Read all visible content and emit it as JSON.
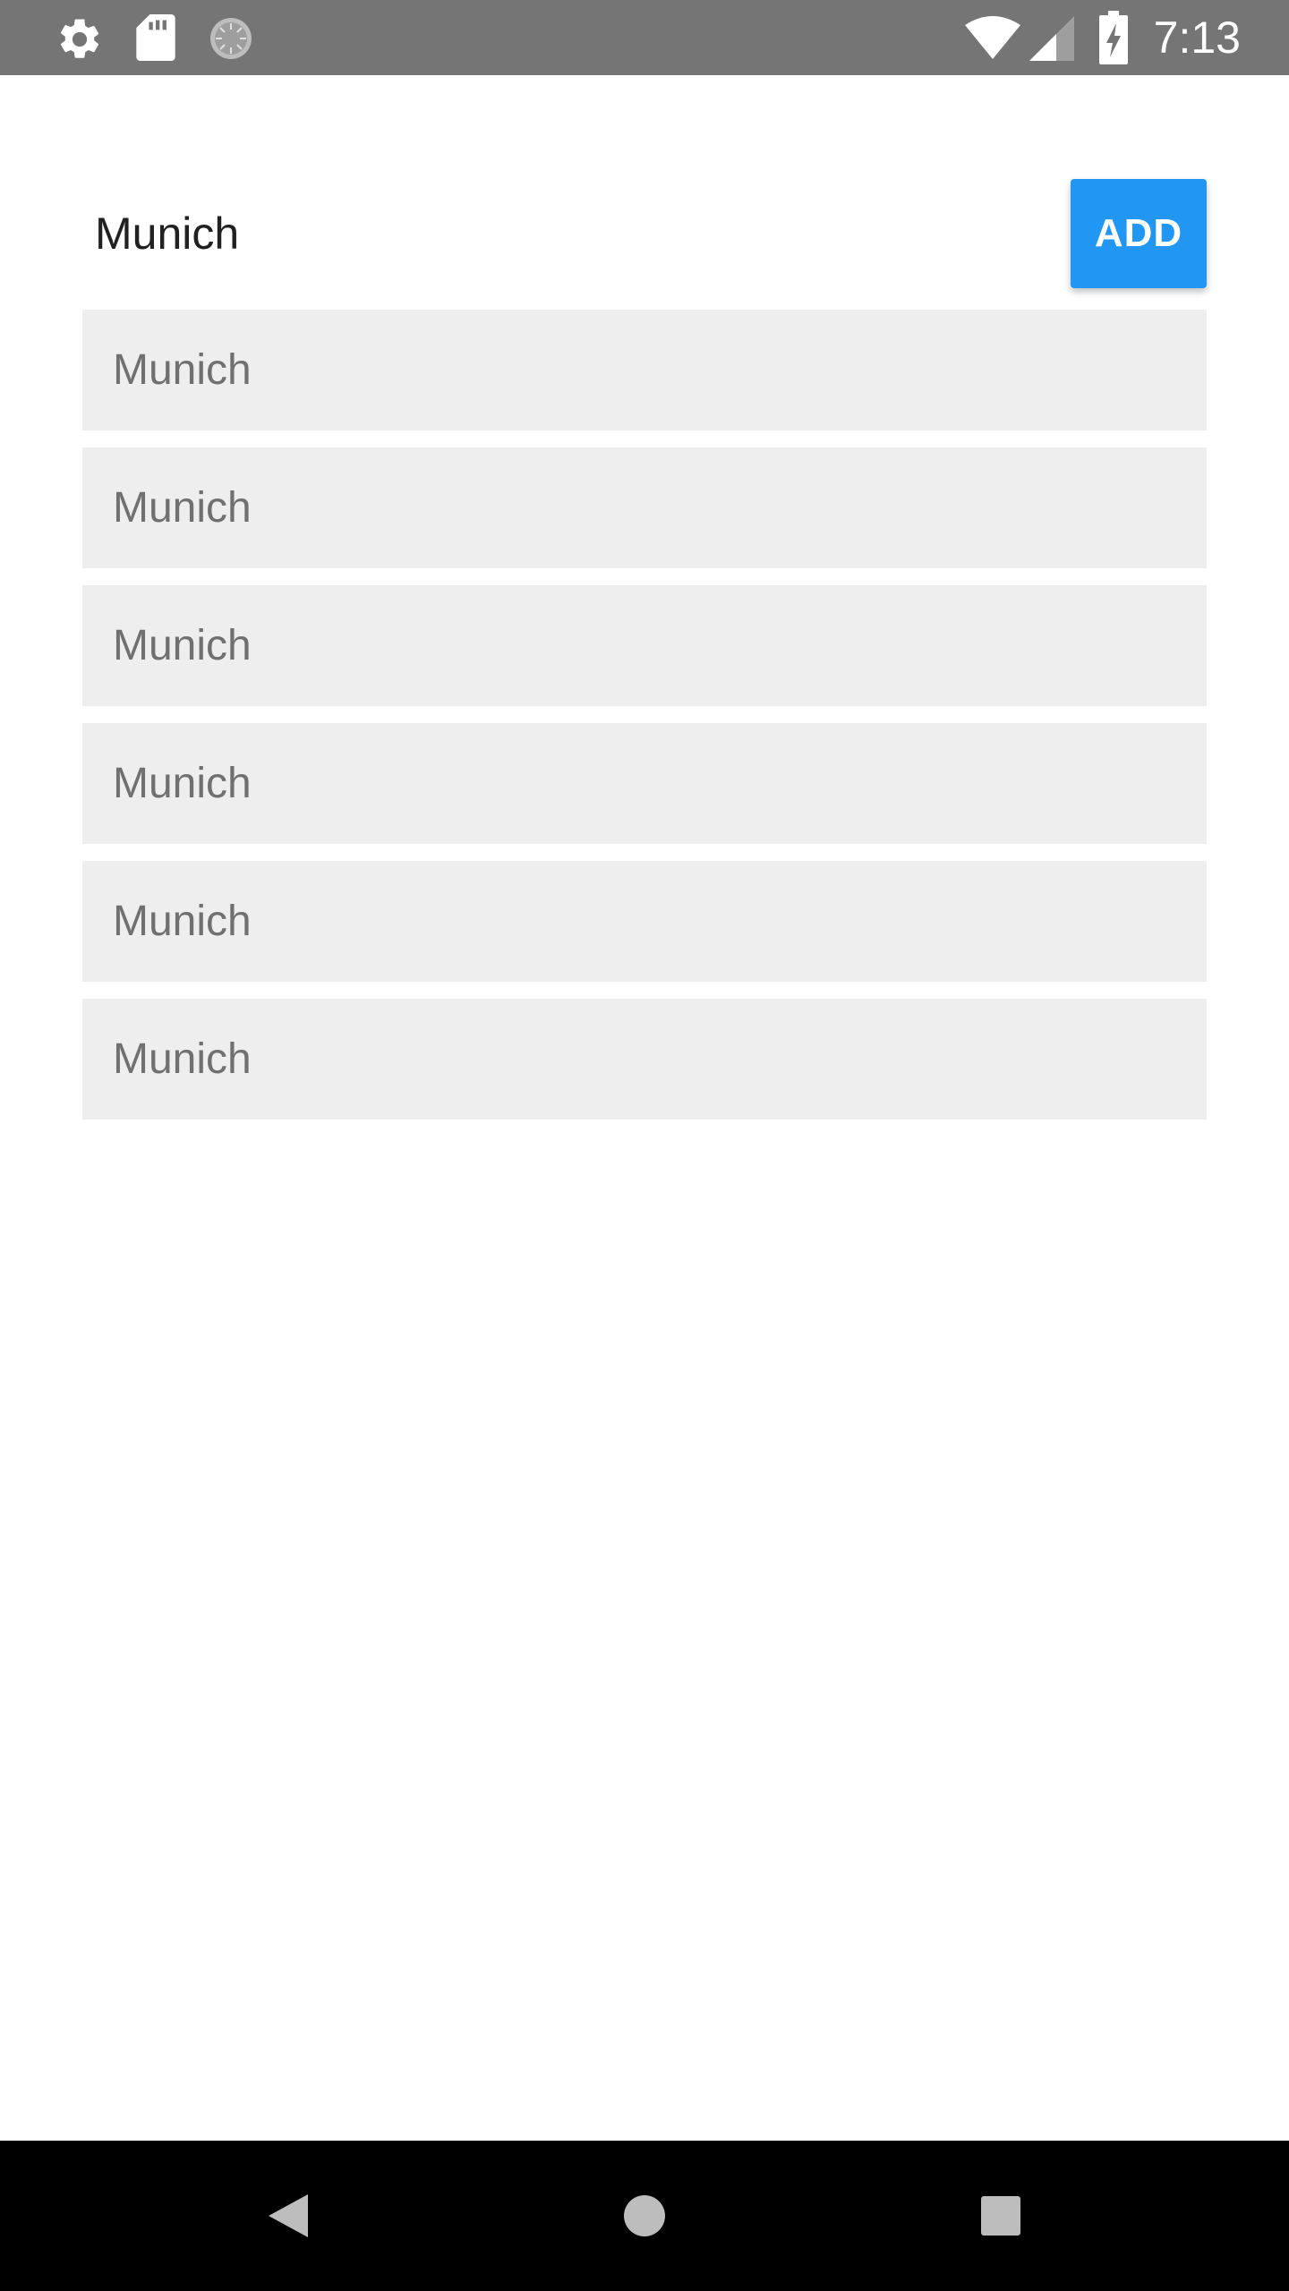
{
  "status_bar": {
    "time": "7:13",
    "icons": [
      "gear-icon",
      "sd-card-icon",
      "loading-spinner-icon",
      "wifi-icon",
      "cell-signal-icon",
      "battery-charging-icon"
    ]
  },
  "form": {
    "input_value": "Munich",
    "add_label": "ADD"
  },
  "cities": [
    "Munich",
    "Munich",
    "Munich",
    "Munich",
    "Munich",
    "Munich"
  ],
  "nav_bar": {
    "icons": [
      "back-icon",
      "home-icon",
      "recents-icon"
    ]
  },
  "colors": {
    "accent": "#2196f3",
    "status_bar": "#757575",
    "list_item_bg": "#eeeeee",
    "list_item_text": "#707070",
    "nav_bar": "#000000"
  }
}
